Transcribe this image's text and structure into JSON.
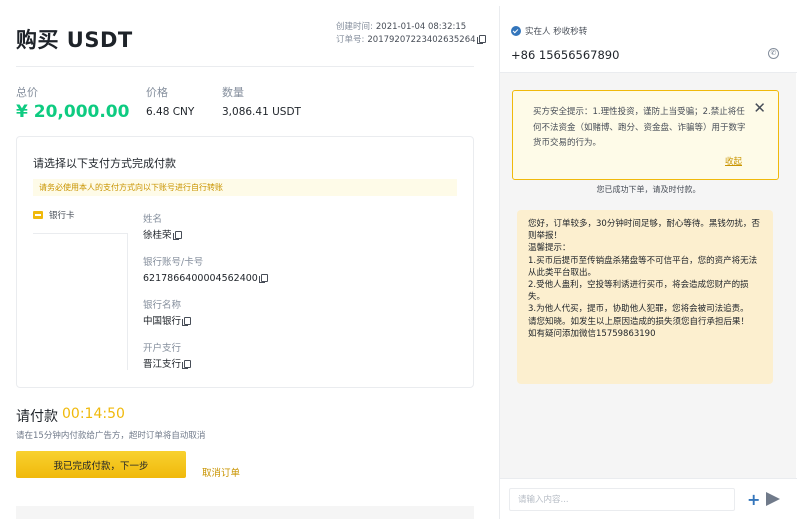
{
  "order": {
    "title": "购买 USDT",
    "created_label": "创建时间:",
    "created_value": "2021-01-04 08:32:15",
    "order_no_label": "订单号:",
    "order_no_value": "20179207223402635264"
  },
  "summary": {
    "total_label": "总价",
    "total_value": "¥ 20,000.00",
    "price_label": "价格",
    "price_value": "6.48 CNY",
    "qty_label": "数量",
    "qty_value": "3,086.41 USDT"
  },
  "payment": {
    "title": "请选择以下支付方式完成付款",
    "warning": "请务必使用本人的支付方式向以下账号进行自行转账",
    "method_label": "银行卡",
    "fields": [
      {
        "label": "姓名",
        "value": "徐桂荣"
      },
      {
        "label": "银行账号/卡号",
        "value": "6217866400004562400"
      },
      {
        "label": "银行名称",
        "value": "中国银行"
      },
      {
        "label": "开户支行",
        "value": "晋江支行"
      }
    ]
  },
  "countdown": {
    "label": "请付款",
    "time": "00:14:50",
    "note": "请在15分钟内付款给广告方，超时订单将自动取消"
  },
  "actions": {
    "done_label": "我已完成付款，下一步",
    "cancel_label": "取消订单"
  },
  "chat": {
    "verified_label": "实在人 秒收秒转",
    "phone": "+86 15656567890",
    "notice_text": "买方安全提示：1.理性投资，谨防上当受骗；2.禁止将任何不法资金（如赌博、跑分、资金盘、诈骗等）用于数字货币交易的行为。",
    "notice_collapse": "收起",
    "system_message": "您已成功下单，请及时付款。",
    "message_lines": [
      "您好，订单较多，30分钟时间足够，耐心等待。黑钱勿扰，否则举报！",
      "温馨提示：",
      "1.买币后提币至传销盘杀猪盘等不可信平台，您的资产将无法从此类平台取出。",
      "2.受他人蛊利，空投等利诱进行买币，将会造成您财产的损失。",
      "3.为他人代买，提币，协助他人犯罪，您将会被司法追责。",
      "请您知晓。如发生以上原因造成的损失须您自行承担后果！",
      "如有疑问添加微信15759863190"
    ],
    "input_placeholder": "请输入内容..."
  },
  "colors": {
    "accent_yellow": "#f0b90b",
    "price_green": "#0ecb81",
    "link_gold": "#c99400",
    "bubble_bg": "#fcefcf"
  },
  "icons": [
    "copy-icon",
    "bank-card-icon",
    "verified-icon",
    "phone-icon",
    "close-icon",
    "plus-icon",
    "send-icon"
  ]
}
